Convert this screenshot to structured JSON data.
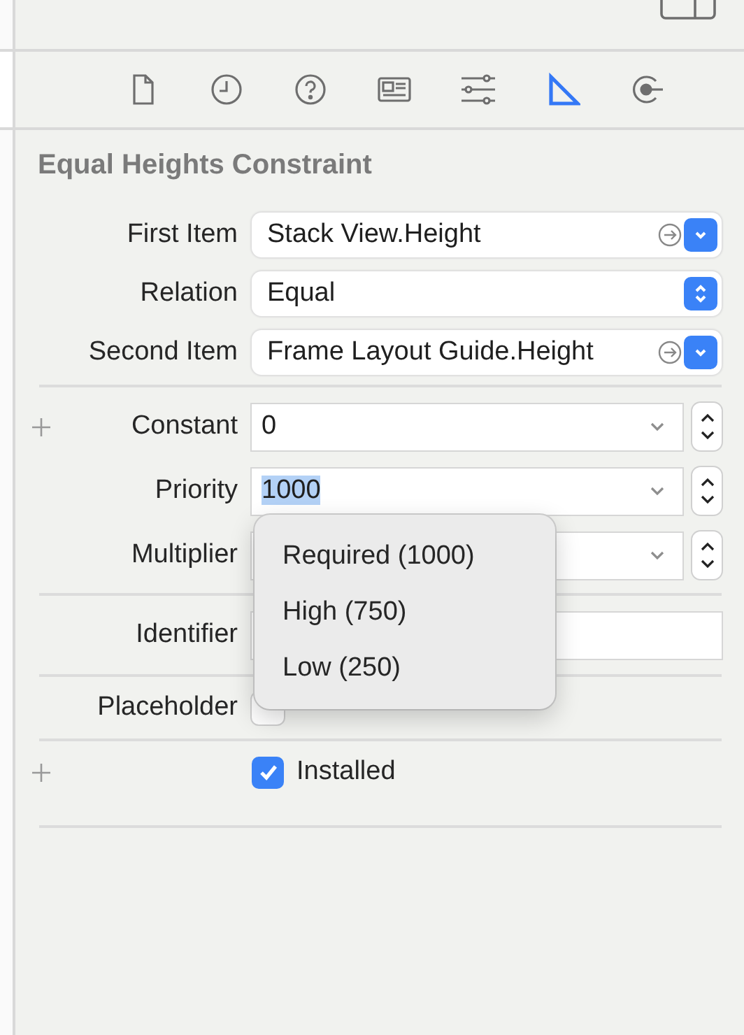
{
  "inspector_tabs": [
    {
      "kind": "file",
      "selected": false
    },
    {
      "kind": "history",
      "selected": false
    },
    {
      "kind": "help",
      "selected": false
    },
    {
      "kind": "identity",
      "selected": false
    },
    {
      "kind": "attributes",
      "selected": false
    },
    {
      "kind": "size",
      "selected": true
    },
    {
      "kind": "connections",
      "selected": false
    }
  ],
  "title": "Equal Heights Constraint",
  "groups": [
    [
      {
        "kind": "item_popup",
        "label": "First Item",
        "value": "Stack View.Height"
      },
      {
        "kind": "popup",
        "label": "Relation",
        "value": "Equal"
      },
      {
        "kind": "item_popup",
        "label": "Second Item",
        "value": "Frame Layout Guide.Height"
      }
    ],
    [
      {
        "kind": "combo",
        "label": "Constant",
        "value": "0",
        "addable": true,
        "text_selected": false
      },
      {
        "kind": "combo",
        "label": "Priority",
        "value": "1000",
        "addable": false,
        "text_selected": true
      },
      {
        "kind": "combo",
        "label": "Multiplier",
        "addable": false
      }
    ],
    [
      {
        "kind": "text",
        "label": "Identifier"
      }
    ],
    [
      {
        "kind": "checkbox",
        "label": "Placeholder",
        "checked": false,
        "addable": false
      }
    ],
    [
      {
        "kind": "checkbox",
        "text": "Installed",
        "checked": true,
        "addable": true
      }
    ]
  ],
  "priority_menu": [
    "Required (1000)",
    "High (750)",
    "Low (250)"
  ]
}
